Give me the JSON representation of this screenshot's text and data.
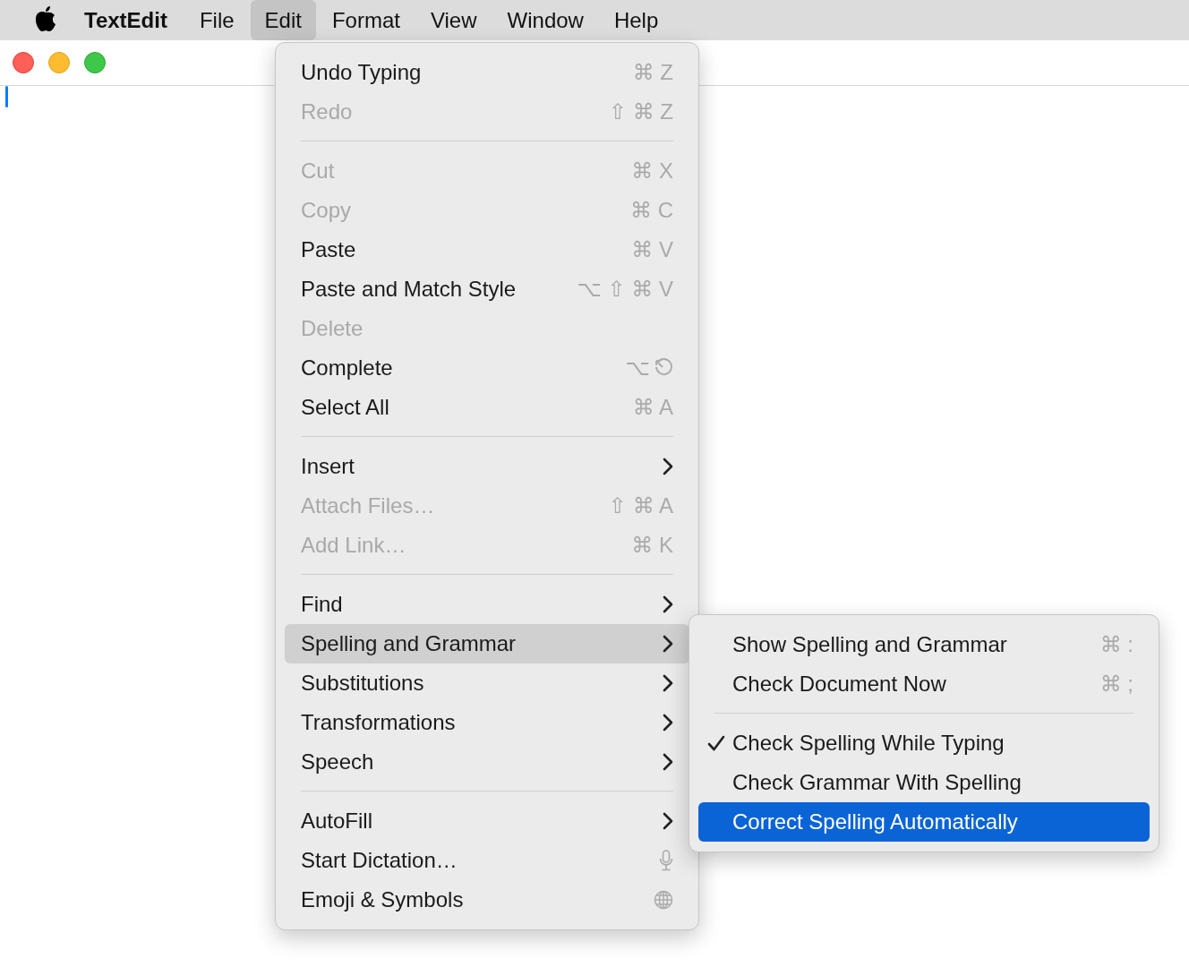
{
  "menu_bar": {
    "app_name": "TextEdit",
    "menus": [
      {
        "label": "File",
        "selected": false
      },
      {
        "label": "Edit",
        "selected": true
      },
      {
        "label": "Format",
        "selected": false
      },
      {
        "label": "View",
        "selected": false
      },
      {
        "label": "Window",
        "selected": false
      },
      {
        "label": "Help",
        "selected": false
      }
    ]
  },
  "edit_menu": {
    "items": [
      {
        "kind": "command",
        "label": "Undo Typing",
        "shortcut": "⌘ Z",
        "disabled": false,
        "selected": false
      },
      {
        "kind": "command",
        "label": "Redo",
        "shortcut": "⇧ ⌘ Z",
        "disabled": true,
        "selected": false
      },
      {
        "kind": "separator"
      },
      {
        "kind": "command",
        "label": "Cut",
        "shortcut": "⌘ X",
        "disabled": true,
        "selected": false
      },
      {
        "kind": "command",
        "label": "Copy",
        "shortcut": "⌘ C",
        "disabled": true,
        "selected": false
      },
      {
        "kind": "command",
        "label": "Paste",
        "shortcut": "⌘ V",
        "disabled": false,
        "selected": false
      },
      {
        "kind": "command",
        "label": "Paste and Match Style",
        "shortcut": "⌥ ⇧ ⌘ V",
        "disabled": false,
        "selected": false
      },
      {
        "kind": "command",
        "label": "Delete",
        "disabled": true,
        "selected": false
      },
      {
        "kind": "completion",
        "label": "Complete",
        "shortcut": "⌥",
        "disabled": false,
        "selected": false
      },
      {
        "kind": "command",
        "label": "Select All",
        "shortcut": "⌘ A",
        "disabled": false,
        "selected": false
      },
      {
        "kind": "separator"
      },
      {
        "kind": "submenu",
        "label": "Insert",
        "disabled": false,
        "selected": false
      },
      {
        "kind": "command",
        "label": "Attach Files…",
        "shortcut": "⇧ ⌘ A",
        "disabled": true,
        "selected": false
      },
      {
        "kind": "command",
        "label": "Add Link…",
        "shortcut": "⌘ K",
        "disabled": true,
        "selected": false
      },
      {
        "kind": "separator"
      },
      {
        "kind": "submenu",
        "label": "Find",
        "disabled": false,
        "selected": false
      },
      {
        "kind": "submenu",
        "label": "Spelling and Grammar",
        "disabled": false,
        "selected": true
      },
      {
        "kind": "submenu",
        "label": "Substitutions",
        "disabled": false,
        "selected": false
      },
      {
        "kind": "submenu",
        "label": "Transformations",
        "disabled": false,
        "selected": false
      },
      {
        "kind": "submenu",
        "label": "Speech",
        "disabled": false,
        "selected": false
      },
      {
        "kind": "separator"
      },
      {
        "kind": "submenu",
        "label": "AutoFill",
        "disabled": false,
        "selected": false
      },
      {
        "kind": "dictation",
        "label": "Start Dictation…",
        "disabled": false,
        "selected": false
      },
      {
        "kind": "symbols",
        "label": "Emoji & Symbols",
        "disabled": false,
        "selected": false
      }
    ]
  },
  "spelling_submenu": {
    "items": [
      {
        "kind": "command",
        "label": "Show Spelling and Grammar",
        "shortcut": "⌘ :",
        "checked": false,
        "selected": false
      },
      {
        "kind": "command",
        "label": "Check Document Now",
        "shortcut": "⌘ ;",
        "checked": false,
        "selected": false
      },
      {
        "kind": "separator"
      },
      {
        "kind": "command",
        "label": "Check Spelling While Typing",
        "checked": true,
        "selected": false
      },
      {
        "kind": "command",
        "label": "Check Grammar With Spelling",
        "checked": false,
        "selected": false
      },
      {
        "kind": "command",
        "label": "Correct Spelling Automatically",
        "checked": false,
        "selected": true
      }
    ]
  }
}
